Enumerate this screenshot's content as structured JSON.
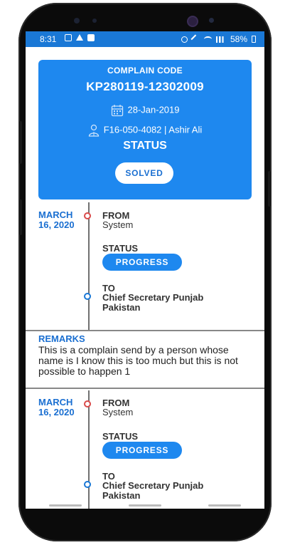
{
  "status_bar": {
    "time": "8:31",
    "battery": "58%",
    "icons": [
      "gallery-icon",
      "alert-icon",
      "check-icon",
      "alarm-icon",
      "mute-icon",
      "wifi-icon",
      "signal-icon",
      "battery-icon"
    ]
  },
  "complaint_card": {
    "code_label": "COMPLAIN CODE",
    "code_value": "KP280119-12302009",
    "date": "28-Jan-2019",
    "user": "F16-050-4082 | Ashir Ali",
    "status_label": "STATUS",
    "status_value": "SOLVED",
    "colors": {
      "card": "#1e88ef",
      "pill_text": "#1a6fd1"
    }
  },
  "entries": [
    {
      "date": "MARCH 16, 2020",
      "from_label": "FROM",
      "from_value": "System",
      "status_label": "STATUS",
      "status_value": "PROGRESS",
      "to_label": "TO",
      "to_value": "Chief Secretary Punjab Pakistan"
    },
    {
      "date": "MARCH 16, 2020",
      "from_label": "FROM",
      "from_value": "System",
      "status_label": "STATUS",
      "status_value": "PROGRESS",
      "to_label": "TO",
      "to_value": "Chief Secretary Punjab Pakistan"
    }
  ],
  "remarks": {
    "title": "REMARKS",
    "text": "This is a complain send by a person whose name is I know this is too much but this is not possible to happen 1"
  }
}
